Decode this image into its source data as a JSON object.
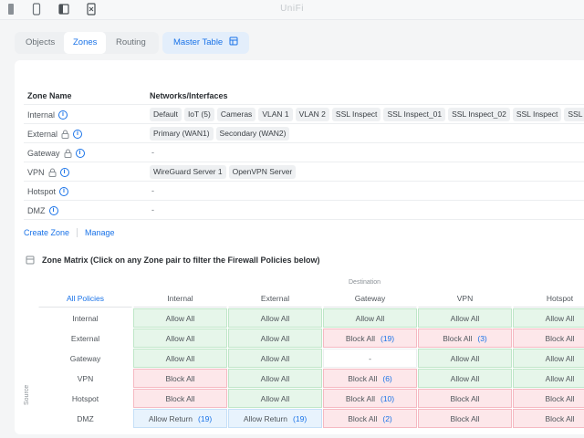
{
  "app": {
    "title": "UniFi"
  },
  "tabs": [
    {
      "label": "Objects",
      "active": false
    },
    {
      "label": "Zones",
      "active": true
    },
    {
      "label": "Routing",
      "active": false
    }
  ],
  "master_table": {
    "label": "Master Table"
  },
  "zones": {
    "header": {
      "name": "Zone Name",
      "networks": "Networks/Interfaces"
    },
    "rows": [
      {
        "name": "Internal",
        "locked": false,
        "networks": [
          "Default",
          "IoT (5)",
          "Cameras",
          "VLAN 1",
          "VLAN 2",
          "SSL Inspect",
          "SSL Inspect_01",
          "SSL Inspect_02",
          "SSL Inspect",
          "SSL Insp"
        ]
      },
      {
        "name": "External",
        "locked": true,
        "networks": [
          "Primary (WAN1)",
          "Secondary (WAN2)"
        ]
      },
      {
        "name": "Gateway",
        "locked": true,
        "networks": [],
        "empty": "-"
      },
      {
        "name": "VPN",
        "locked": true,
        "networks": [
          "WireGuard Server 1",
          "OpenVPN Server"
        ]
      },
      {
        "name": "Hotspot",
        "locked": false,
        "networks": [],
        "empty": "-"
      },
      {
        "name": "DMZ",
        "locked": false,
        "networks": [],
        "empty": "-"
      }
    ]
  },
  "actions": {
    "create": "Create Zone",
    "manage": "Manage"
  },
  "matrix": {
    "title": "Zone Matrix (Click on any Zone pair to filter the Firewall Policies below)",
    "destination_label": "Destination",
    "source_label": "Source",
    "corner": "All Policies",
    "columns": [
      "Internal",
      "External",
      "Gateway",
      "VPN",
      "Hotspot"
    ],
    "rows": [
      {
        "source": "Internal",
        "cells": [
          {
            "text": "Allow All",
            "kind": "allow"
          },
          {
            "text": "Allow All",
            "kind": "allow"
          },
          {
            "text": "Allow All",
            "kind": "allow"
          },
          {
            "text": "Allow All",
            "kind": "allow"
          },
          {
            "text": "Allow All",
            "kind": "allow"
          }
        ]
      },
      {
        "source": "External",
        "cells": [
          {
            "text": "Allow All",
            "kind": "allow"
          },
          {
            "text": "Allow All",
            "kind": "allow"
          },
          {
            "text": "Block All",
            "kind": "block",
            "count": "(19)"
          },
          {
            "text": "Block All",
            "kind": "block",
            "count": "(3)"
          },
          {
            "text": "Block All",
            "kind": "block"
          }
        ]
      },
      {
        "source": "Gateway",
        "cells": [
          {
            "text": "Allow All",
            "kind": "allow"
          },
          {
            "text": "Allow All",
            "kind": "allow"
          },
          {
            "text": "-",
            "kind": "plain"
          },
          {
            "text": "Allow All",
            "kind": "allow"
          },
          {
            "text": "Allow All",
            "kind": "allow"
          }
        ]
      },
      {
        "source": "VPN",
        "cells": [
          {
            "text": "Block All",
            "kind": "block"
          },
          {
            "text": "Allow All",
            "kind": "allow"
          },
          {
            "text": "Block All",
            "kind": "block",
            "count": "(6)"
          },
          {
            "text": "Allow All",
            "kind": "allow"
          },
          {
            "text": "Allow All",
            "kind": "allow"
          }
        ]
      },
      {
        "source": "Hotspot",
        "cells": [
          {
            "text": "Block All",
            "kind": "block"
          },
          {
            "text": "Allow All",
            "kind": "allow"
          },
          {
            "text": "Block All",
            "kind": "block",
            "count": "(10)"
          },
          {
            "text": "Block All",
            "kind": "block"
          },
          {
            "text": "Block All",
            "kind": "block"
          }
        ]
      },
      {
        "source": "DMZ",
        "cells": [
          {
            "text": "Allow Return",
            "kind": "ret",
            "count": "(19)"
          },
          {
            "text": "Allow Return",
            "kind": "ret",
            "count": "(19)"
          },
          {
            "text": "Block All",
            "kind": "block",
            "count": "(2)"
          },
          {
            "text": "Block All",
            "kind": "block"
          },
          {
            "text": "Block All",
            "kind": "block"
          }
        ]
      }
    ]
  },
  "colors": {
    "accent": "#1a73e8",
    "allow": "#e6f6ea",
    "block": "#fde7ea",
    "return": "#e8f3fd"
  }
}
